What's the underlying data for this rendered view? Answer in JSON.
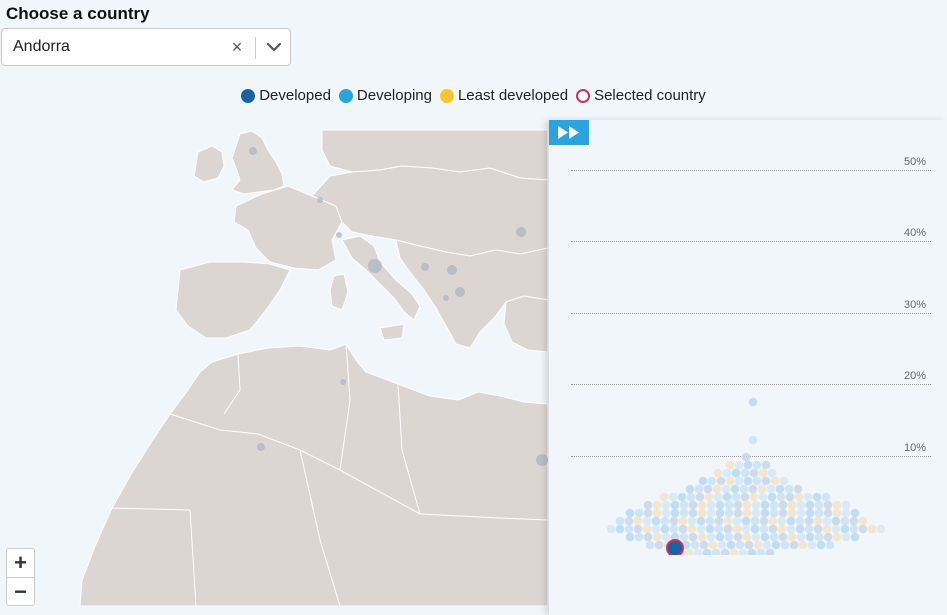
{
  "heading": "Choose a country",
  "select": {
    "value": "Andorra",
    "clear_icon": "×"
  },
  "legend": [
    {
      "label": "Developed",
      "color": "#1565a5",
      "ring": false
    },
    {
      "label": "Developing",
      "color": "#2aa4de",
      "ring": false
    },
    {
      "label": "Least developed",
      "color": "#f8c52c",
      "ring": false
    },
    {
      "label": "Selected country",
      "color": "#d92a5b",
      "ring": true
    }
  ],
  "panel": {
    "play_icon": "fast-forward-icon",
    "y_ticks": [
      "50%",
      "40%",
      "30%",
      "20%",
      "10%"
    ]
  },
  "zoom": {
    "in": "+",
    "out": "−"
  },
  "colors": {
    "land": "#dcd6d3",
    "border": "#ffffff",
    "background": "#f1f6fa",
    "selected": "#d92a5b",
    "developed": "#1565a5"
  }
}
